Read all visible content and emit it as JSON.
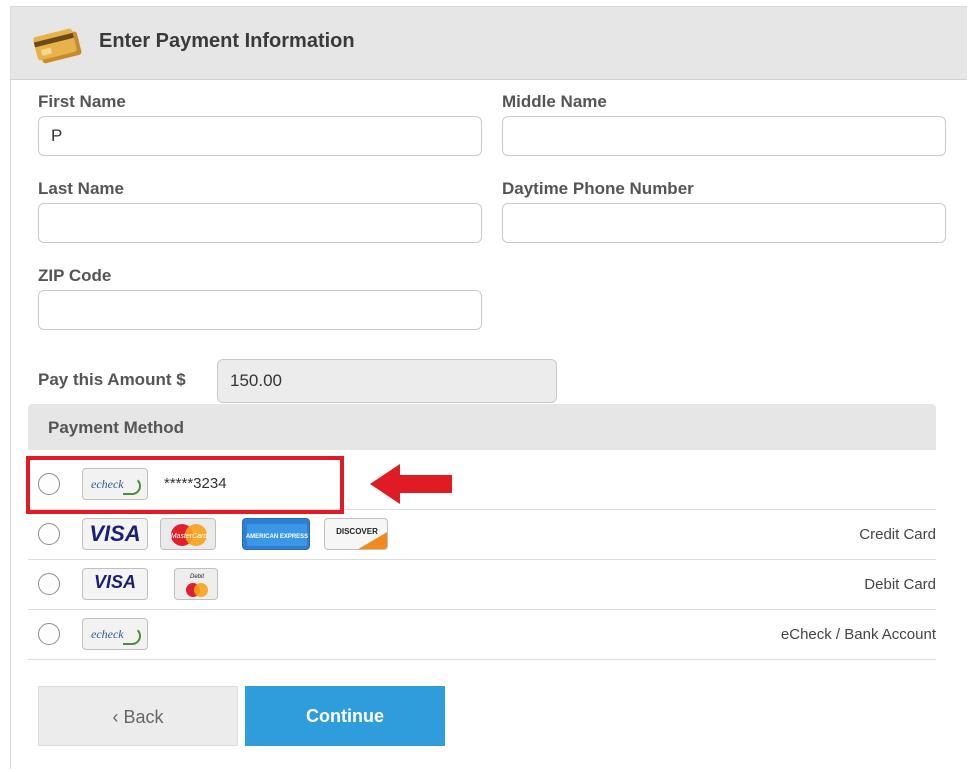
{
  "header": {
    "title": "Enter Payment Information",
    "icon": "credit-cards-icon"
  },
  "form": {
    "first_name": {
      "label": "First Name",
      "value": "P"
    },
    "middle_name": {
      "label": "Middle Name",
      "value": ""
    },
    "last_name": {
      "label": "Last Name",
      "value": ""
    },
    "phone": {
      "label": "Daytime Phone Number",
      "value": ""
    },
    "zip": {
      "label": "ZIP Code",
      "value": ""
    },
    "amount": {
      "label": "Pay this Amount $",
      "value": "150.00"
    }
  },
  "payment_method": {
    "title": "Payment Method",
    "saved": {
      "logo": "echeck",
      "masked": "*****3234"
    },
    "options": [
      {
        "label": "Credit Card",
        "logos": [
          "VISA",
          "MasterCard",
          "AMERICAN EXPRESS",
          "DISCOVER"
        ]
      },
      {
        "label": "Debit Card",
        "logos": [
          "VISA",
          "Debit"
        ]
      },
      {
        "label": "eCheck / Bank Account",
        "logos": [
          "echeck"
        ]
      }
    ]
  },
  "actions": {
    "back": "‹ Back",
    "continue": "Continue"
  },
  "colors": {
    "accent": "#2f9ddc",
    "highlight": "#e01b24",
    "header_bg": "#e6e6e6"
  }
}
